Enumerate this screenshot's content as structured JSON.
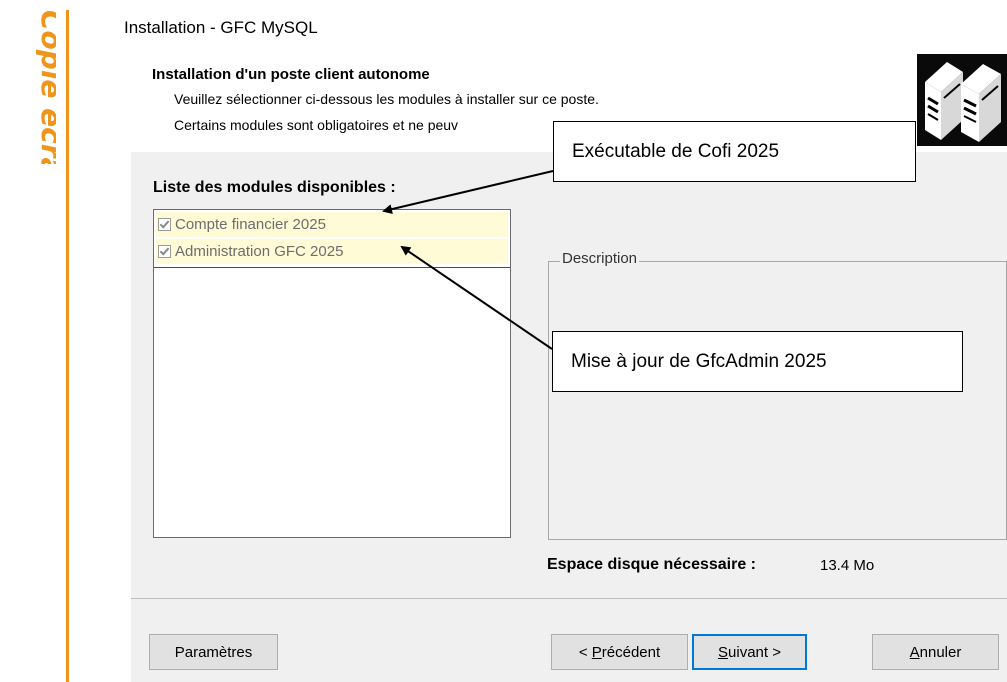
{
  "side_label": "Copie écran",
  "window": {
    "title": "Installation - GFC MySQL"
  },
  "header": {
    "title": "Installation d'un poste client autonome",
    "line1": "Veuillez sélectionner ci-dessous les modules à installer sur ce poste.",
    "line2": "Certains modules sont obligatoires et ne peuv"
  },
  "modules": {
    "caption": "Liste des modules disponibles :",
    "items": [
      {
        "label": "Compte financier 2025",
        "checked": true,
        "disabled": true
      },
      {
        "label": "Administration GFC 2025",
        "checked": true,
        "disabled": true
      }
    ]
  },
  "description": {
    "legend": "Description"
  },
  "disk_space": {
    "label": "Espace disque nécessaire :",
    "value": "13.4 Mo"
  },
  "buttons": {
    "params": "Paramètres",
    "prev_prefix": "< ",
    "prev_mnemonic": "P",
    "prev_rest": "récédent",
    "next_mnemonic": "S",
    "next_rest": "uivant >",
    "cancel_mnemonic": "A",
    "cancel_rest": "nnuler"
  },
  "callouts": {
    "cofi": "Exécutable de Cofi 2025",
    "gfcadmin": "Mise à jour de GfcAdmin 2025"
  },
  "colors": {
    "accent_orange": "#f0951c",
    "selection_bg": "#fffbd6",
    "focus_blue": "#0078d7"
  }
}
